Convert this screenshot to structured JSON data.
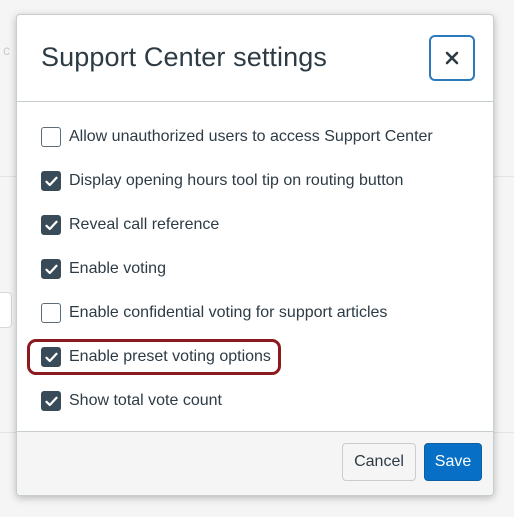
{
  "modal": {
    "title": "Support Center settings",
    "close_icon": "close-icon"
  },
  "options": [
    {
      "label": "Allow unauthorized users to access Support Center",
      "checked": false
    },
    {
      "label": "Display opening hours tool tip on routing button",
      "checked": true
    },
    {
      "label": "Reveal call reference",
      "checked": true
    },
    {
      "label": "Enable voting",
      "checked": true
    },
    {
      "label": "Enable confidential voting for support articles",
      "checked": false
    },
    {
      "label": "Enable preset voting options",
      "checked": true,
      "highlighted": true
    },
    {
      "label": "Show total vote count",
      "checked": true
    }
  ],
  "footer": {
    "cancel_label": "Cancel",
    "save_label": "Save"
  },
  "colors": {
    "primary": "#0770c6",
    "checkbox_checked": "#394b58",
    "highlight": "#8b1a1f",
    "close_border": "#2b7abc"
  }
}
